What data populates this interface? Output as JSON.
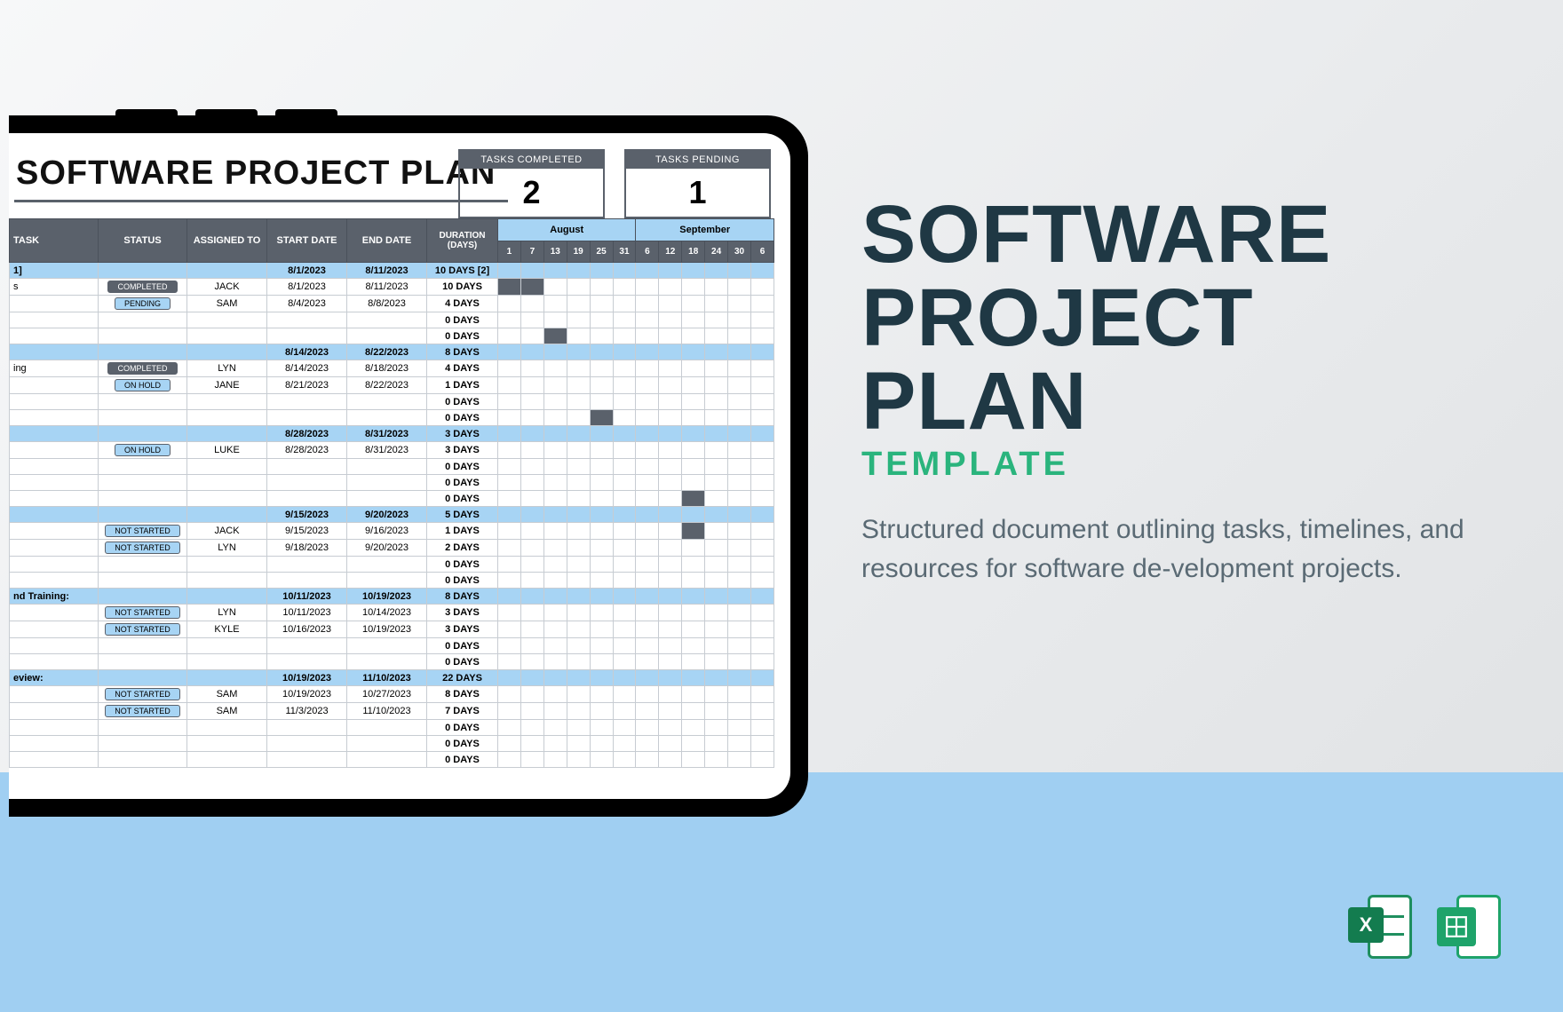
{
  "promo": {
    "title_l1": "SOFTWARE",
    "title_l2": "PROJECT",
    "title_l3": "PLAN",
    "subtitle": "TEMPLATE",
    "description": "Structured document outlining tasks, timelines, and resources for software de‐velopment projects."
  },
  "sheet": {
    "title": "SOFTWARE PROJECT PLAN",
    "kpi": [
      {
        "label": "TASKS COMPLETED",
        "value": "2"
      },
      {
        "label": "TASKS PENDING",
        "value": "1"
      }
    ],
    "columns": {
      "task": "TASK",
      "status": "STATUS",
      "assigned": "ASSIGNED TO",
      "start": "START DATE",
      "end": "END DATE",
      "duration": "DURATION (DAYS)"
    },
    "months": [
      "August",
      "September"
    ],
    "days": [
      "1",
      "7",
      "13",
      "19",
      "25",
      "31",
      "6",
      "12",
      "18",
      "24",
      "30",
      "6"
    ],
    "groups": [
      {
        "task": "1]",
        "start": "8/1/2023",
        "end": "8/11/2023",
        "duration": "10 DAYS [2]",
        "rows": [
          {
            "task": "s",
            "status": "COMPLETED",
            "assigned": "JACK",
            "start": "8/1/2023",
            "end": "8/11/2023",
            "duration": "10 DAYS",
            "gantt": [
              0,
              1
            ]
          },
          {
            "task": "",
            "status": "PENDING",
            "assigned": "SAM",
            "start": "8/4/2023",
            "end": "8/8/2023",
            "duration": "4 DAYS",
            "gantt": []
          },
          {
            "task": "",
            "status": "",
            "assigned": "",
            "start": "",
            "end": "",
            "duration": "0 DAYS",
            "gantt": []
          },
          {
            "task": "",
            "status": "",
            "assigned": "",
            "start": "",
            "end": "",
            "duration": "0 DAYS",
            "gantt": [
              2
            ]
          }
        ]
      },
      {
        "task": "",
        "start": "8/14/2023",
        "end": "8/22/2023",
        "duration": "8 DAYS",
        "rows": [
          {
            "task": "ing",
            "status": "COMPLETED",
            "assigned": "LYN",
            "start": "8/14/2023",
            "end": "8/18/2023",
            "duration": "4 DAYS",
            "gantt": []
          },
          {
            "task": "",
            "status": "ON HOLD",
            "assigned": "JANE",
            "start": "8/21/2023",
            "end": "8/22/2023",
            "duration": "1 DAYS",
            "gantt": []
          },
          {
            "task": "",
            "status": "",
            "assigned": "",
            "start": "",
            "end": "",
            "duration": "0 DAYS",
            "gantt": []
          },
          {
            "task": "",
            "status": "",
            "assigned": "",
            "start": "",
            "end": "",
            "duration": "0 DAYS",
            "gantt": [
              4
            ]
          }
        ]
      },
      {
        "task": "",
        "start": "8/28/2023",
        "end": "8/31/2023",
        "duration": "3 DAYS",
        "rows": [
          {
            "task": "",
            "status": "ON HOLD",
            "assigned": "LUKE",
            "start": "8/28/2023",
            "end": "8/31/2023",
            "duration": "3 DAYS",
            "gantt": []
          },
          {
            "task": "",
            "status": "",
            "assigned": "",
            "start": "",
            "end": "",
            "duration": "0 DAYS",
            "gantt": []
          },
          {
            "task": "",
            "status": "",
            "assigned": "",
            "start": "",
            "end": "",
            "duration": "0 DAYS",
            "gantt": []
          },
          {
            "task": "",
            "status": "",
            "assigned": "",
            "start": "",
            "end": "",
            "duration": "0 DAYS",
            "gantt": [
              8
            ]
          }
        ]
      },
      {
        "task": "",
        "start": "9/15/2023",
        "end": "9/20/2023",
        "duration": "5 DAYS",
        "rows": [
          {
            "task": "",
            "status": "NOT STARTED",
            "assigned": "JACK",
            "start": "9/15/2023",
            "end": "9/16/2023",
            "duration": "1 DAYS",
            "gantt": [
              8
            ]
          },
          {
            "task": "",
            "status": "NOT STARTED",
            "assigned": "LYN",
            "start": "9/18/2023",
            "end": "9/20/2023",
            "duration": "2 DAYS",
            "gantt": []
          },
          {
            "task": "",
            "status": "",
            "assigned": "",
            "start": "",
            "end": "",
            "duration": "0 DAYS",
            "gantt": []
          },
          {
            "task": "",
            "status": "",
            "assigned": "",
            "start": "",
            "end": "",
            "duration": "0 DAYS",
            "gantt": []
          }
        ]
      },
      {
        "task": "nd Training:",
        "start": "10/11/2023",
        "end": "10/19/2023",
        "duration": "8 DAYS",
        "rows": [
          {
            "task": "",
            "status": "NOT STARTED",
            "assigned": "LYN",
            "start": "10/11/2023",
            "end": "10/14/2023",
            "duration": "3 DAYS",
            "gantt": []
          },
          {
            "task": "",
            "status": "NOT STARTED",
            "assigned": "KYLE",
            "start": "10/16/2023",
            "end": "10/19/2023",
            "duration": "3 DAYS",
            "gantt": []
          },
          {
            "task": "",
            "status": "",
            "assigned": "",
            "start": "",
            "end": "",
            "duration": "0 DAYS",
            "gantt": []
          },
          {
            "task": "",
            "status": "",
            "assigned": "",
            "start": "",
            "end": "",
            "duration": "0 DAYS",
            "gantt": []
          }
        ]
      },
      {
        "task": "eview:",
        "start": "10/19/2023",
        "end": "11/10/2023",
        "duration": "22 DAYS",
        "rows": [
          {
            "task": "",
            "status": "NOT STARTED",
            "assigned": "SAM",
            "start": "10/19/2023",
            "end": "10/27/2023",
            "duration": "8 DAYS",
            "gantt": []
          },
          {
            "task": "",
            "status": "NOT STARTED",
            "assigned": "SAM",
            "start": "11/3/2023",
            "end": "11/10/2023",
            "duration": "7 DAYS",
            "gantt": []
          },
          {
            "task": "",
            "status": "",
            "assigned": "",
            "start": "",
            "end": "",
            "duration": "0 DAYS",
            "gantt": []
          },
          {
            "task": "",
            "status": "",
            "assigned": "",
            "start": "",
            "end": "",
            "duration": "0 DAYS",
            "gantt": []
          },
          {
            "task": "",
            "status": "",
            "assigned": "",
            "start": "",
            "end": "",
            "duration": "0 DAYS",
            "gantt": []
          }
        ]
      }
    ]
  },
  "colors": {
    "slate": "#5a616b",
    "light_blue": "#a7d4f4"
  }
}
